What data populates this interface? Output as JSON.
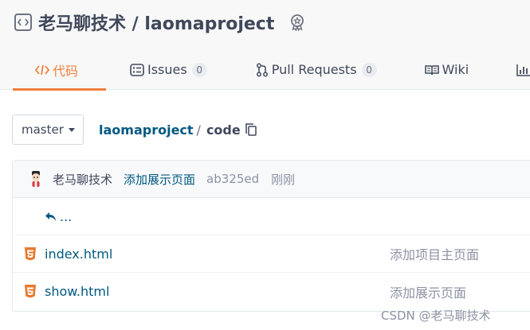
{
  "repo": {
    "title": "老马聊技术 / laomaproject",
    "icon": "repo-code-icon",
    "star_icon": "award-icon"
  },
  "tabs": [
    {
      "label": "代码",
      "icon": "code-icon",
      "active": true
    },
    {
      "label": "Issues",
      "icon": "issues-icon",
      "badge": "0"
    },
    {
      "label": "Pull Requests",
      "icon": "pull-request-icon",
      "badge": "0"
    },
    {
      "label": "Wiki",
      "icon": "wiki-book-icon"
    },
    {
      "label": "",
      "icon": "stats-chart-icon"
    }
  ],
  "branch": {
    "value": "master"
  },
  "breadcrumb": {
    "root": "laomaproject",
    "separator": "/",
    "current": "code"
  },
  "commit": {
    "author": "老马聊技术",
    "message": "添加展示页面",
    "hash": "ab325ed",
    "time": "刚刚"
  },
  "back": {
    "label": "..."
  },
  "files": [
    {
      "name": "index.html",
      "commit": "添加项目主页面",
      "icon": "html5-icon"
    },
    {
      "name": "show.html",
      "commit": "添加展示页面",
      "icon": "html5-icon"
    }
  ],
  "watermark": "CSDN @老马聊技术",
  "colors": {
    "accent": "#f0803b",
    "link": "#005980",
    "muted": "#8c92a4",
    "html_icon": "#e57a2e"
  }
}
